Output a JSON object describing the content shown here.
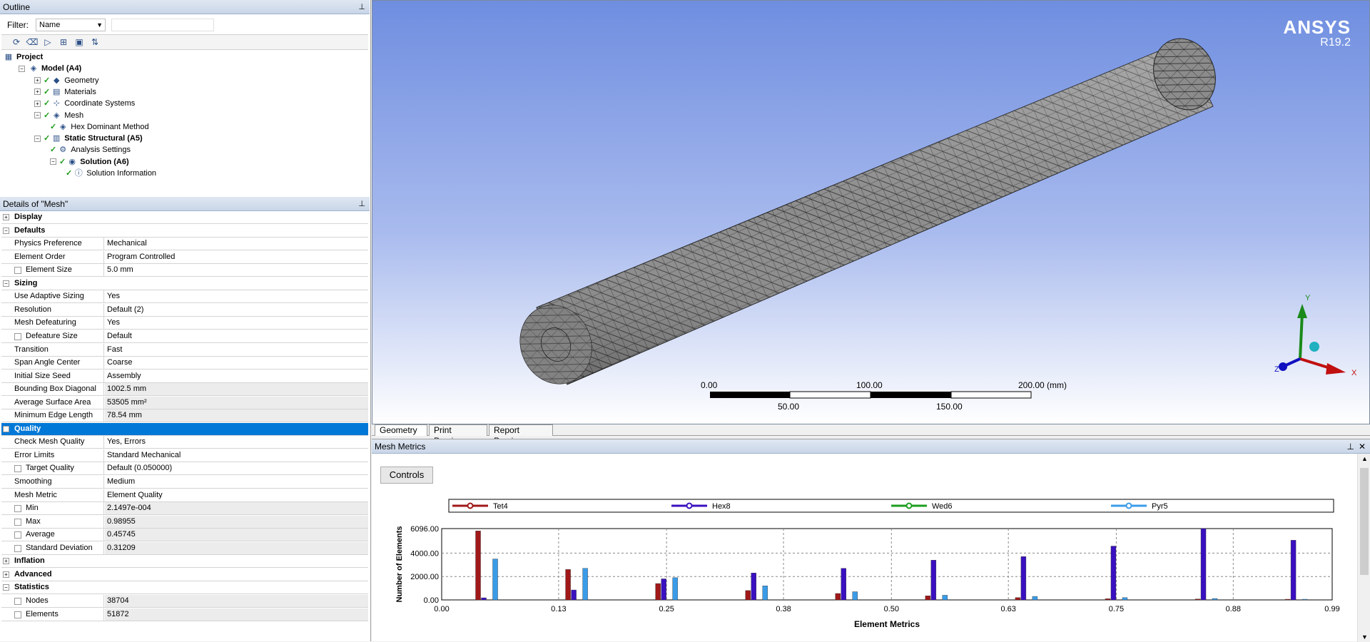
{
  "outline": {
    "title": "Outline",
    "filter_label": "Filter:",
    "filter_value": "Name",
    "tree": [
      {
        "label": "Project",
        "depth": 0,
        "bold": true,
        "icon": "project-icon"
      },
      {
        "label": "Model (A4)",
        "depth": 1,
        "bold": true,
        "icon": "model-icon"
      },
      {
        "label": "Geometry",
        "depth": 2,
        "bold": false,
        "icon": "geometry-icon"
      },
      {
        "label": "Materials",
        "depth": 2,
        "bold": false,
        "icon": "materials-icon"
      },
      {
        "label": "Coordinate Systems",
        "depth": 2,
        "bold": false,
        "icon": "coordinate-systems-icon"
      },
      {
        "label": "Mesh",
        "depth": 2,
        "bold": false,
        "icon": "mesh-icon"
      },
      {
        "label": "Hex Dominant Method",
        "depth": 3,
        "bold": false,
        "icon": "mesh-method-icon"
      },
      {
        "label": "Static Structural (A5)",
        "depth": 2,
        "bold": true,
        "icon": "static-structural-icon"
      },
      {
        "label": "Analysis Settings",
        "depth": 3,
        "bold": false,
        "icon": "analysis-settings-icon"
      },
      {
        "label": "Solution (A6)",
        "depth": 3,
        "bold": true,
        "icon": "solution-icon"
      },
      {
        "label": "Solution Information",
        "depth": 4,
        "bold": false,
        "icon": "solution-information-icon"
      }
    ]
  },
  "details": {
    "title": "Details of \"Mesh\"",
    "rows": [
      {
        "type": "cat",
        "label": "Display",
        "pm": "+"
      },
      {
        "type": "cat",
        "label": "Defaults",
        "pm": "-"
      },
      {
        "type": "row",
        "k": "Physics Preference",
        "v": "Mechanical"
      },
      {
        "type": "row",
        "k": "Element Order",
        "v": "Program Controlled"
      },
      {
        "type": "row",
        "k": "Element Size",
        "v": "5.0 mm",
        "cb": true
      },
      {
        "type": "cat",
        "label": "Sizing",
        "pm": "-"
      },
      {
        "type": "row",
        "k": "Use Adaptive Sizing",
        "v": "Yes"
      },
      {
        "type": "row",
        "k": "Resolution",
        "v": "Default (2)"
      },
      {
        "type": "row",
        "k": "Mesh Defeaturing",
        "v": "Yes"
      },
      {
        "type": "row",
        "k": "Defeature Size",
        "v": "Default",
        "cb": true
      },
      {
        "type": "row",
        "k": "Transition",
        "v": "Fast"
      },
      {
        "type": "row",
        "k": "Span Angle Center",
        "v": "Coarse"
      },
      {
        "type": "row",
        "k": "Initial Size Seed",
        "v": "Assembly"
      },
      {
        "type": "row",
        "k": "Bounding Box Diagonal",
        "v": "1002.5 mm",
        "gray": true
      },
      {
        "type": "row",
        "k": "Average Surface Area",
        "v": "53505 mm²",
        "gray": true
      },
      {
        "type": "row",
        "k": "Minimum Edge Length",
        "v": "78.54 mm",
        "gray": true
      },
      {
        "type": "cat",
        "label": "Quality",
        "pm": "-",
        "sel": true
      },
      {
        "type": "row",
        "k": "Check Mesh Quality",
        "v": "Yes, Errors"
      },
      {
        "type": "row",
        "k": "Error Limits",
        "v": "Standard Mechanical"
      },
      {
        "type": "row",
        "k": "Target Quality",
        "v": "Default (0.050000)",
        "cb": true
      },
      {
        "type": "row",
        "k": "Smoothing",
        "v": "Medium"
      },
      {
        "type": "row",
        "k": "Mesh Metric",
        "v": "Element Quality"
      },
      {
        "type": "row",
        "k": "Min",
        "v": "2.1497e-004",
        "cb": true,
        "gray": true
      },
      {
        "type": "row",
        "k": "Max",
        "v": "0.98955",
        "cb": true,
        "gray": true
      },
      {
        "type": "row",
        "k": "Average",
        "v": "0.45745",
        "cb": true,
        "gray": true
      },
      {
        "type": "row",
        "k": "Standard Deviation",
        "v": "0.31209",
        "cb": true,
        "gray": true
      },
      {
        "type": "cat",
        "label": "Inflation",
        "pm": "+"
      },
      {
        "type": "cat",
        "label": "Advanced",
        "pm": "+"
      },
      {
        "type": "cat",
        "label": "Statistics",
        "pm": "-"
      },
      {
        "type": "row",
        "k": "Nodes",
        "v": "38704",
        "cb": true,
        "gray": true
      },
      {
        "type": "row",
        "k": "Elements",
        "v": "51872",
        "cb": true,
        "gray": true
      }
    ]
  },
  "viewport": {
    "brand": "ANSYS",
    "version": "R19.2",
    "scale_labels_top": [
      "0.00",
      "100.00",
      "200.00 (mm)"
    ],
    "scale_labels_bottom": [
      "50.00",
      "150.00"
    ],
    "axis_labels": {
      "x": "X",
      "y": "Y",
      "z": "Z"
    },
    "colors": {
      "bg_top": "#6f8ee0",
      "bg_bottom": "#ffffff",
      "mesh_fill": "#8c8c8c"
    },
    "tabs": [
      "Geometry",
      "Print Preview",
      "Report Preview"
    ],
    "active_tab": "Geometry"
  },
  "metrics": {
    "title": "Mesh Metrics",
    "controls_label": "Controls"
  },
  "chart_data": {
    "type": "bar",
    "xlabel": "Element Metrics",
    "ylabel": "Number of Elements",
    "xlim": [
      0.0,
      0.99
    ],
    "ylim": [
      0,
      6096
    ],
    "x_ticks": [
      "0.00",
      "0.13",
      "0.25",
      "0.38",
      "0.50",
      "0.63",
      "0.75",
      "0.88",
      "0.99"
    ],
    "y_ticks": [
      "0.00",
      "2000.00",
      "4000.00",
      "6096.00"
    ],
    "legend_position": "top",
    "bins": [
      0.05,
      0.15,
      0.25,
      0.35,
      0.45,
      0.55,
      0.65,
      0.75,
      0.85,
      0.95
    ],
    "series": [
      {
        "name": "Tet4",
        "color": "#a01818",
        "values": [
          5900,
          2600,
          1400,
          800,
          550,
          350,
          200,
          100,
          80,
          60
        ]
      },
      {
        "name": "Hex8",
        "color": "#3a10c0",
        "values": [
          180,
          850,
          1800,
          2300,
          2700,
          3400,
          3700,
          4600,
          6096,
          5100
        ]
      },
      {
        "name": "Wed6",
        "color": "#1e9e1e",
        "values": [
          0,
          0,
          0,
          0,
          0,
          0,
          0,
          0,
          0,
          0
        ]
      },
      {
        "name": "Pyr5",
        "color": "#3a9ce8",
        "values": [
          3500,
          2700,
          1900,
          1200,
          700,
          400,
          300,
          200,
          120,
          60
        ]
      }
    ]
  }
}
